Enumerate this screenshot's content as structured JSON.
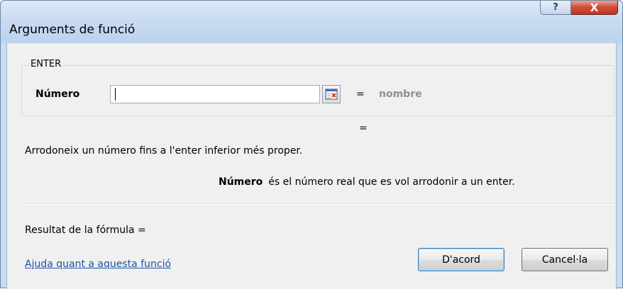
{
  "window": {
    "title": "Arguments de funció",
    "help_glyph": "?",
    "close_glyph": "X"
  },
  "function": {
    "name": "ENTER",
    "argument": {
      "label": "Número",
      "value": "",
      "equals": "=",
      "hint": "nombre"
    },
    "result_equals": "=",
    "description": "Arrodoneix un número fins a l'enter inferior més proper.",
    "argument_help": {
      "name": "Número",
      "text": "és el número real que es vol arrodonir a un enter."
    },
    "formula_result": "Resultat de la fórmula ="
  },
  "footer": {
    "help_link": "Ajuda quant a aquesta funció",
    "ok_label": "D'acord",
    "cancel_label": "Cancel·la"
  },
  "colors": {
    "link": "#1e52a8",
    "hint": "#8f8f8f",
    "close_button": "#c0341f"
  },
  "icons": {
    "collapse": "collapse-dialog-icon"
  }
}
